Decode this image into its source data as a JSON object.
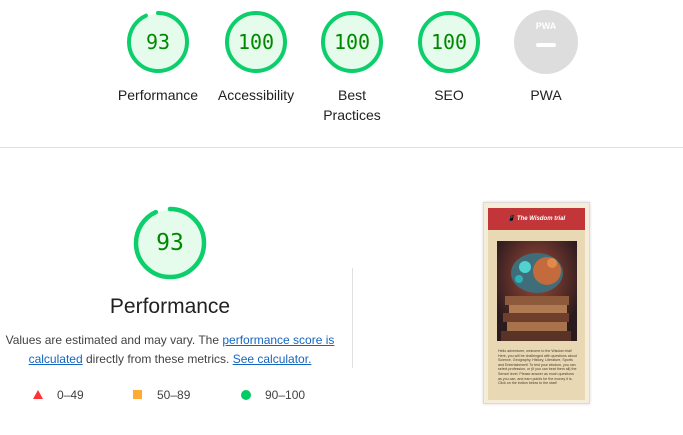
{
  "top_gauges": [
    {
      "label": "Performance",
      "score": "93",
      "value": 93
    },
    {
      "label": "Accessibility",
      "score": "100",
      "value": 100
    },
    {
      "label": "Best Practices",
      "score": "100",
      "value": 100
    },
    {
      "label": "SEO",
      "score": "100",
      "value": 100
    }
  ],
  "pwa": {
    "label": "PWA",
    "badge_text": "PWA"
  },
  "performance": {
    "score": "93",
    "value": 93,
    "title": "Performance",
    "desc_prefix": "Values are estimated and may vary. The ",
    "link_score": "performance score is calculated",
    "desc_mid": " directly from these metrics. ",
    "link_calc": "See calculator."
  },
  "legend": [
    {
      "range": "0–49",
      "shape": "triangle",
      "color": "#ff3333"
    },
    {
      "range": "50–89",
      "shape": "square",
      "color": "#ffaa33"
    },
    {
      "range": "90–100",
      "shape": "circle",
      "color": "#00cc66"
    }
  ],
  "screenshot": {
    "header": "📱 The Wisdom trial",
    "body_text": "Hello adventurer, welcome to the Wisdom trial! Here, you will be challenged with questions about Science, Geography, History, Literature, Sports and Entertainment! To test your wisdom, you can select profession, or (if you can beat them all) the Sensei level. Please answer as much questions as you can, and earn points for the money it is. Click on the button below to the start!"
  },
  "colors": {
    "pass": "#0cce6b",
    "pass_fill": "#e5fcec",
    "pass_text": "#008800",
    "pwa_gray": "#dddddd"
  }
}
